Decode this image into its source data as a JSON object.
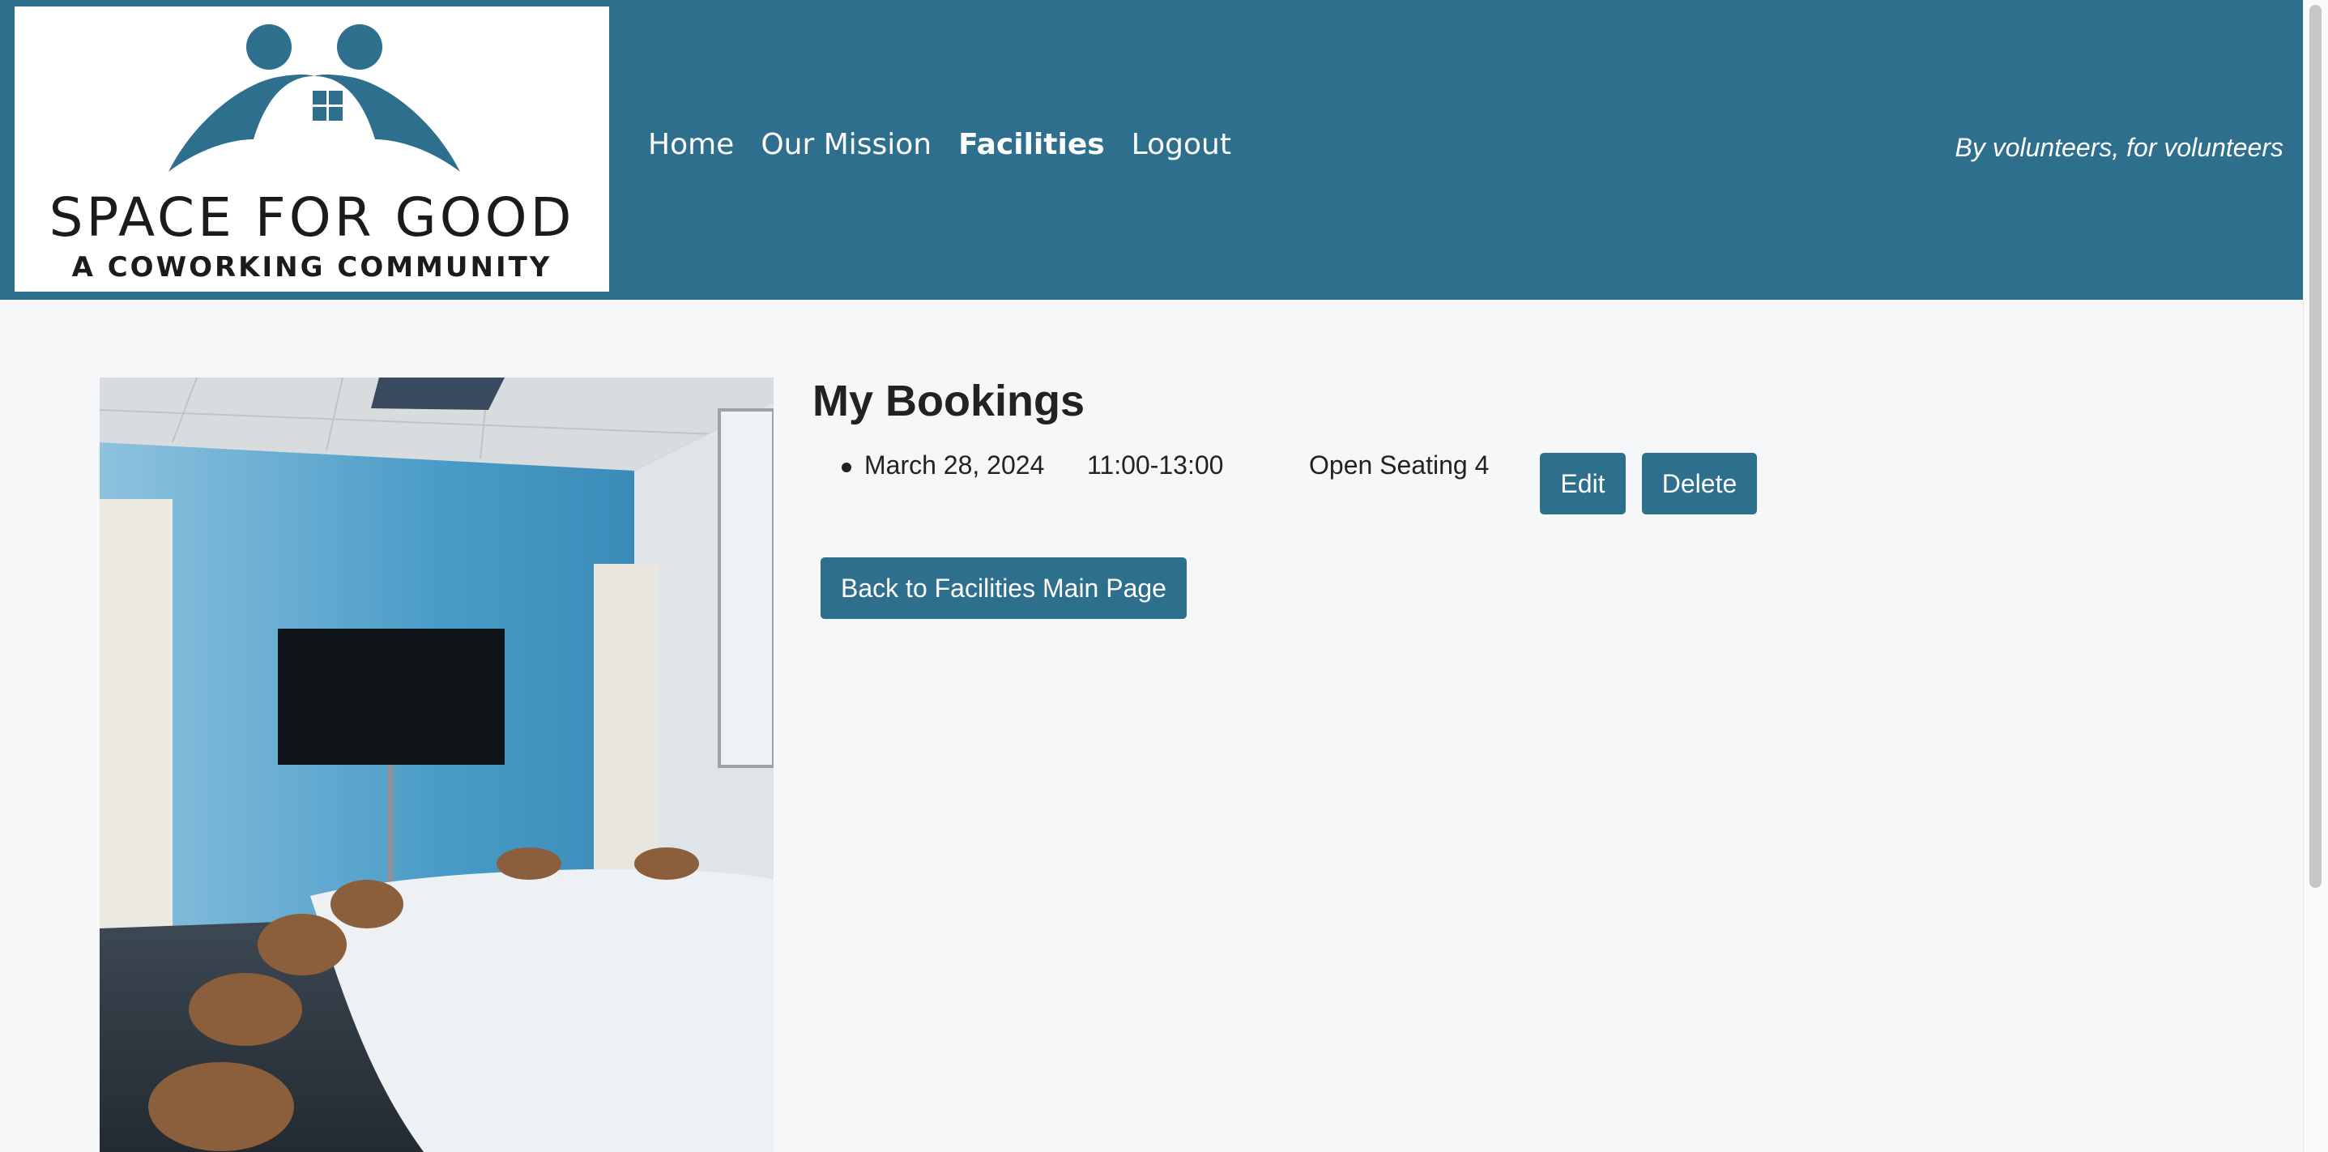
{
  "brand": {
    "logo_title": "SPACE FOR GOOD",
    "logo_subtitle": "A COWORKING COMMUNITY",
    "color": "#2e6f8e"
  },
  "nav": {
    "items": [
      {
        "label": "Home",
        "active": false
      },
      {
        "label": "Our Mission",
        "active": false
      },
      {
        "label": "Facilities",
        "active": true
      },
      {
        "label": "Logout",
        "active": false
      }
    ]
  },
  "tagline": "By volunteers, for volunteers",
  "main": {
    "heading": "My Bookings",
    "bookings": [
      {
        "date": "March 28, 2024",
        "time": "11:00-13:00",
        "space": "Open Seating 4",
        "edit_label": "Edit",
        "delete_label": "Delete"
      }
    ],
    "back_button_label": "Back to Facilities Main Page"
  }
}
